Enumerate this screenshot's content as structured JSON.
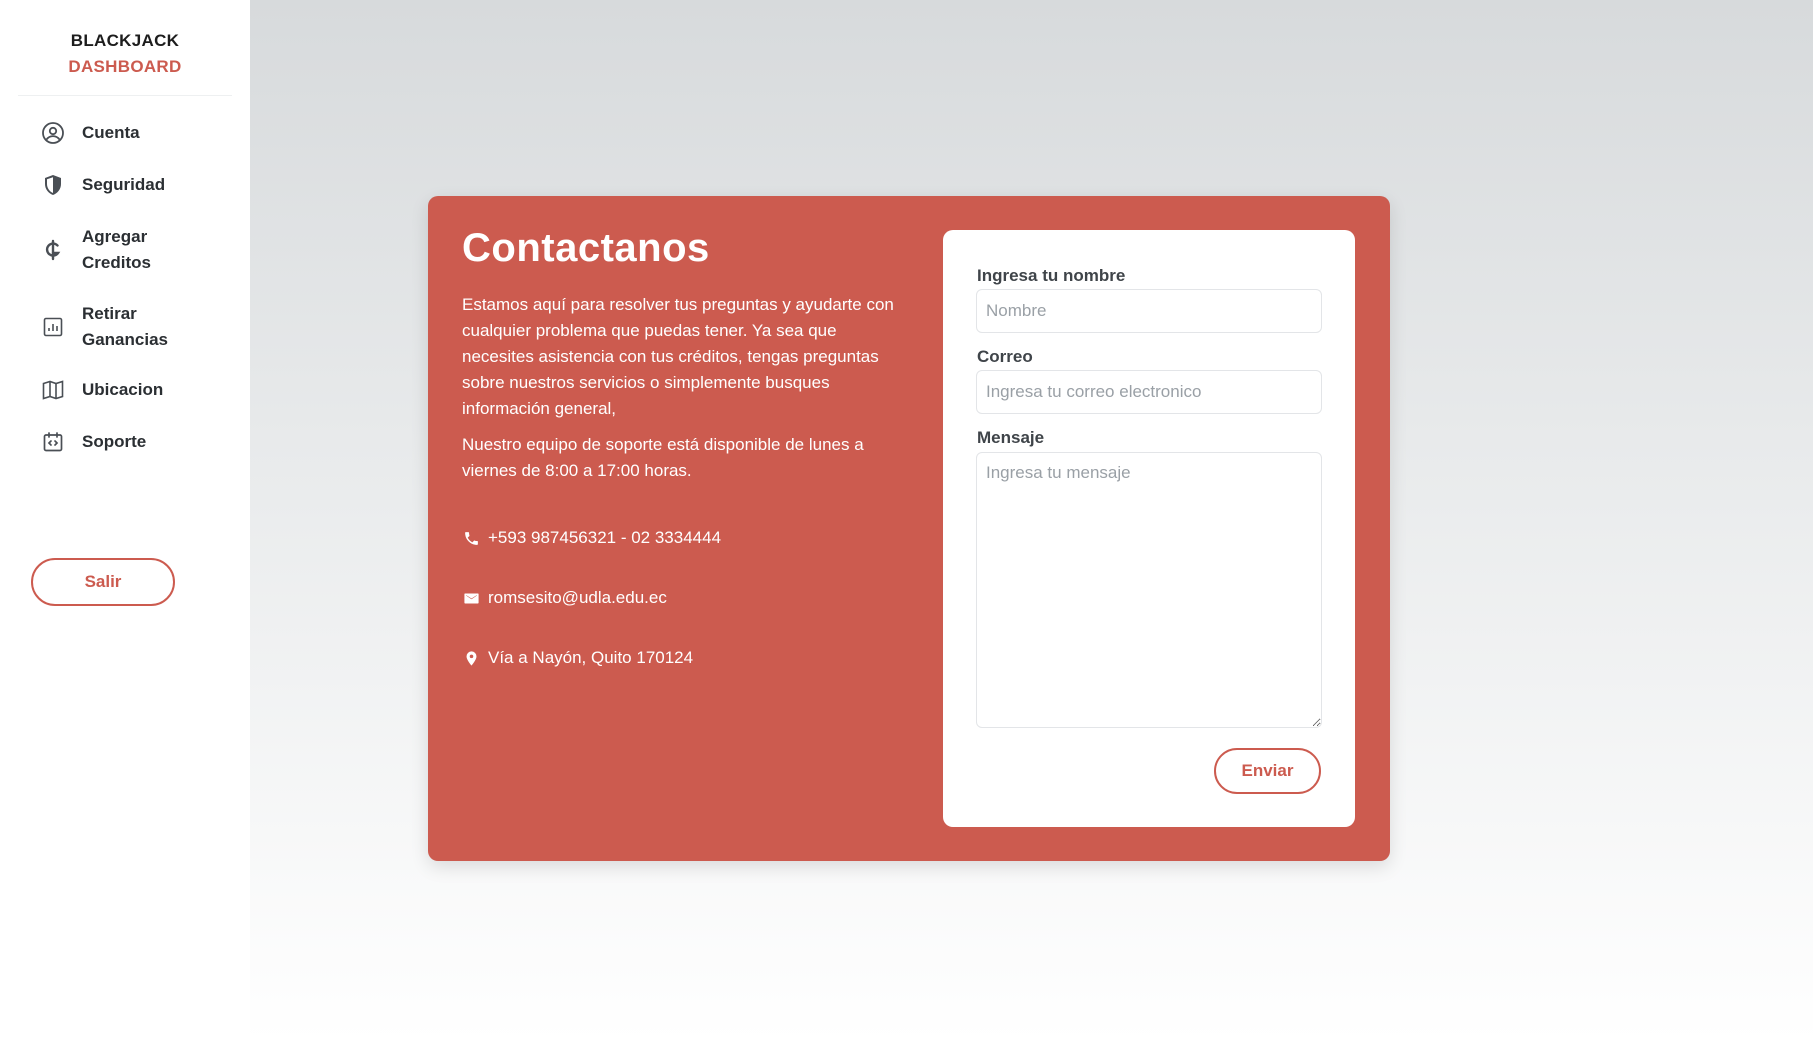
{
  "brand": {
    "line1": "BLACKJACK",
    "line2": "DASHBOARD",
    "accent_color": "#cc5b4f"
  },
  "sidebar": {
    "items": [
      {
        "label": "Cuenta",
        "icon": "user-circle-icon"
      },
      {
        "label": "Seguridad",
        "icon": "shield-icon"
      },
      {
        "label": "Agregar Creditos",
        "icon": "currency-icon"
      },
      {
        "label": "Retirar Ganancias",
        "icon": "chart-icon"
      },
      {
        "label": "Ubicacion",
        "icon": "map-icon"
      },
      {
        "label": "Soporte",
        "icon": "code-icon"
      }
    ],
    "logout_label": "Salir"
  },
  "contact": {
    "title": "Contactanos",
    "description": "Estamos aquí para resolver tus preguntas y ayudarte con cualquier problema que puedas tener. Ya sea que necesites asistencia con tus créditos, tengas preguntas sobre nuestros servicios o simplemente busques información general,",
    "schedule": "Nuestro equipo de soporte está disponible de lunes a viernes de 8:00 a 17:00 horas.",
    "phone": "+593 987456321 - 02 3334444",
    "email": "romsesito@udla.edu.ec",
    "address": "Vía a Nayón, Quito 170124",
    "card_color": "#cc5b4f"
  },
  "form": {
    "name_label": "Ingresa tu nombre",
    "name_placeholder": "Nombre",
    "email_label": "Correo",
    "email_placeholder": "Ingresa tu correo electronico",
    "message_label": "Mensaje",
    "message_placeholder": "Ingresa tu mensaje",
    "submit_label": "Enviar"
  }
}
